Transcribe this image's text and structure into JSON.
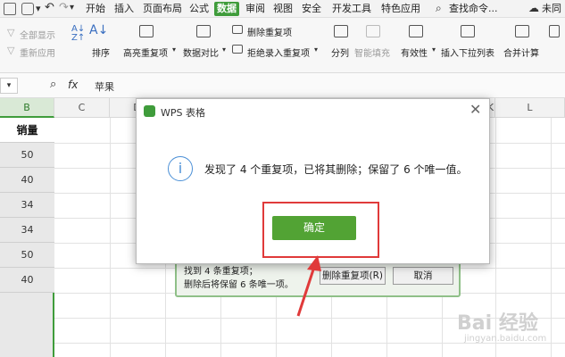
{
  "menubar": {
    "items": [
      "开始",
      "插入",
      "页面布局",
      "公式",
      "数据",
      "审阅",
      "视图",
      "安全",
      "开发工具",
      "特色应用"
    ],
    "active": "数据",
    "search": "查找命令...",
    "right_label": "未同"
  },
  "ribbon": {
    "show_all": "全部显示",
    "reapply": "重新应用",
    "sort": "排序",
    "highlight_dup": "高亮重复项",
    "data_compare": "数据对比",
    "delete_dup": "删除重复项",
    "reject_dup": "拒绝录入重复项",
    "split": "分列",
    "smart_fill": "智能填充",
    "validity": "有效性",
    "insert_dropdown": "插入下拉列表",
    "merge_calc": "合并计算"
  },
  "formula_bar": {
    "fx": "fx",
    "value": "苹果"
  },
  "grid": {
    "col_b": "B",
    "columns": [
      "C",
      "D",
      "I",
      "J",
      "K",
      "L"
    ],
    "header_cell": "销量",
    "values": [
      "50",
      "40",
      "34",
      "34",
      "50",
      "40"
    ]
  },
  "dialog": {
    "title": "WPS 表格",
    "message": "发现了 4 个重复项，已将其删除；保留了 6 个唯一值。",
    "ok_label": "确定"
  },
  "back_dialog": {
    "line1": "找到 4 条重复项；",
    "line2": "删除后将保留 6 条唯一项。",
    "delete_label": "删除重复项(R)",
    "cancel_label": "取消"
  },
  "watermark": {
    "brand": "Bai 经验",
    "url": "jingyan.baidu.com"
  },
  "colors": {
    "accent": "#3f9c3b",
    "ok_button": "#52a334",
    "highlight": "#e03a3a"
  }
}
